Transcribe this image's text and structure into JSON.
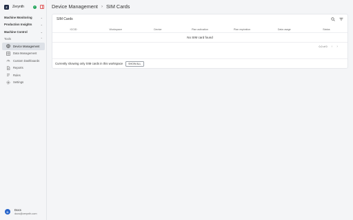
{
  "app": {
    "name": "Zerynth",
    "logo_letter": "Z",
    "status_check": "✓"
  },
  "sidebar": {
    "sections": [
      {
        "label": "Machine Monitoring"
      },
      {
        "label": "Production Insights"
      },
      {
        "label": "Machine Control"
      },
      {
        "label": "Tools"
      }
    ],
    "items": [
      {
        "label": "Device Management",
        "active": true
      },
      {
        "label": "Data Management"
      },
      {
        "label": "Custom Dashboards"
      },
      {
        "label": "Reports"
      },
      {
        "label": "Rules"
      },
      {
        "label": "Settings"
      }
    ],
    "user": {
      "initial": "D",
      "name": "Docs",
      "email": "docs@zerynth.com"
    }
  },
  "breadcrumb": {
    "parent": "Device Management",
    "separator": "›",
    "current": "SIM Cards"
  },
  "card": {
    "title": "SIM Cards",
    "columns": [
      "ICCID",
      "Workspace",
      "Device",
      "Plan activation",
      "Plan expiration",
      "Data usage",
      "Status"
    ],
    "empty_message": "No SIM card found",
    "pagination": "0-0 of 0",
    "filter_text": "Currently showing only SIM cards in this workspace",
    "show_all_label": "SHOW ALL"
  },
  "colors": {
    "accent": "#2563c9",
    "status_ok": "#22a55b",
    "active_bg": "#dde1e7"
  }
}
